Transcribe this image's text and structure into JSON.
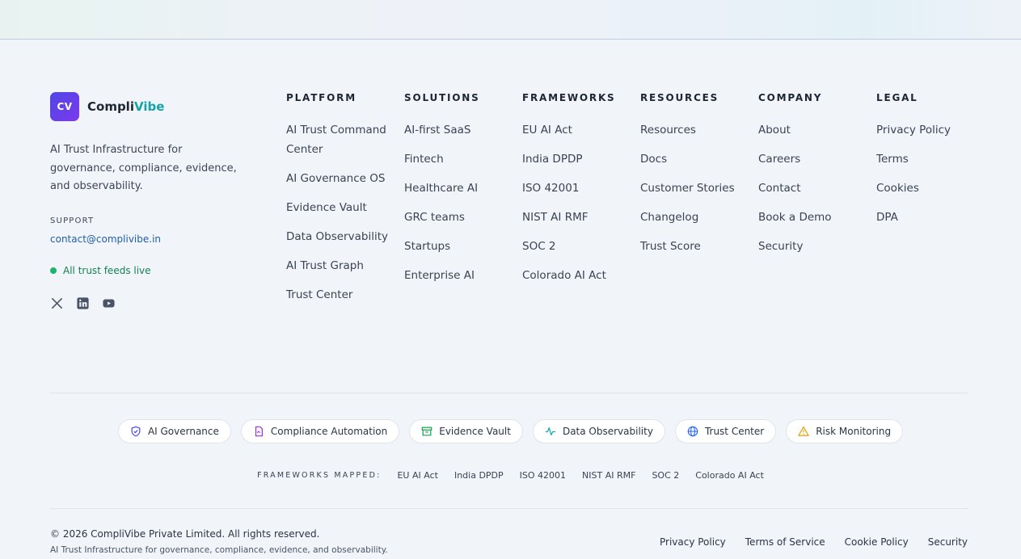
{
  "brand": {
    "logo_text": "CV",
    "name_part1": "Compli",
    "name_part2": "Vibe",
    "accent_color": "#14a3a8",
    "logo_gradient": [
      "#4f46e5",
      "#7c3aed"
    ]
  },
  "tagline": "AI Trust Infrastructure for governance, compliance, evidence, and observability.",
  "support": {
    "label": "SUPPORT",
    "email": "contact@complivibe.in"
  },
  "status": {
    "text": "All trust feeds live",
    "color": "#1db56d"
  },
  "socials": [
    {
      "name": "x-icon"
    },
    {
      "name": "linkedin-icon"
    },
    {
      "name": "youtube-icon"
    }
  ],
  "columns": [
    {
      "title": "PLATFORM",
      "items": [
        "AI Trust Command Center",
        "AI Governance OS",
        "Evidence Vault",
        "Data Observability",
        "AI Trust Graph",
        "Trust Center"
      ]
    },
    {
      "title": "SOLUTIONS",
      "items": [
        "AI-first SaaS",
        "Fintech",
        "Healthcare AI",
        "GRC teams",
        "Startups",
        "Enterprise AI"
      ]
    },
    {
      "title": "FRAMEWORKS",
      "items": [
        "EU AI Act",
        "India DPDP",
        "ISO 42001",
        "NIST AI RMF",
        "SOC 2",
        "Colorado AI Act"
      ]
    },
    {
      "title": "RESOURCES",
      "items": [
        "Resources",
        "Docs",
        "Customer Stories",
        "Changelog",
        "Trust Score"
      ]
    },
    {
      "title": "COMPANY",
      "items": [
        "About",
        "Careers",
        "Contact",
        "Book a Demo",
        "Security"
      ]
    },
    {
      "title": "LEGAL",
      "items": [
        "Privacy Policy",
        "Terms",
        "Cookies",
        "DPA"
      ]
    }
  ],
  "chips": [
    {
      "label": "AI Governance",
      "icon": "shield-icon",
      "color": "#4f46e5"
    },
    {
      "label": "Compliance Automation",
      "icon": "document-icon",
      "color": "#9333ea"
    },
    {
      "label": "Evidence Vault",
      "icon": "archive-icon",
      "color": "#16a34a"
    },
    {
      "label": "Data Observability",
      "icon": "pulse-icon",
      "color": "#0ea5b7"
    },
    {
      "label": "Trust Center",
      "icon": "globe-icon",
      "color": "#2563eb"
    },
    {
      "label": "Risk Monitoring",
      "icon": "warning-icon",
      "color": "#e59e0b"
    }
  ],
  "frameworks_mapped": {
    "label": "FRAMEWORKS MAPPED:",
    "items": [
      "EU AI Act",
      "India DPDP",
      "ISO 42001",
      "NIST AI RMF",
      "SOC 2",
      "Colorado AI Act"
    ]
  },
  "footer": {
    "copyright": "© 2026 CompliVibe Private Limited. All rights reserved.",
    "sub": "AI Trust Infrastructure for governance, compliance, evidence, and observability.",
    "links": [
      "Privacy Policy",
      "Terms of Service",
      "Cookie Policy",
      "Security"
    ]
  }
}
